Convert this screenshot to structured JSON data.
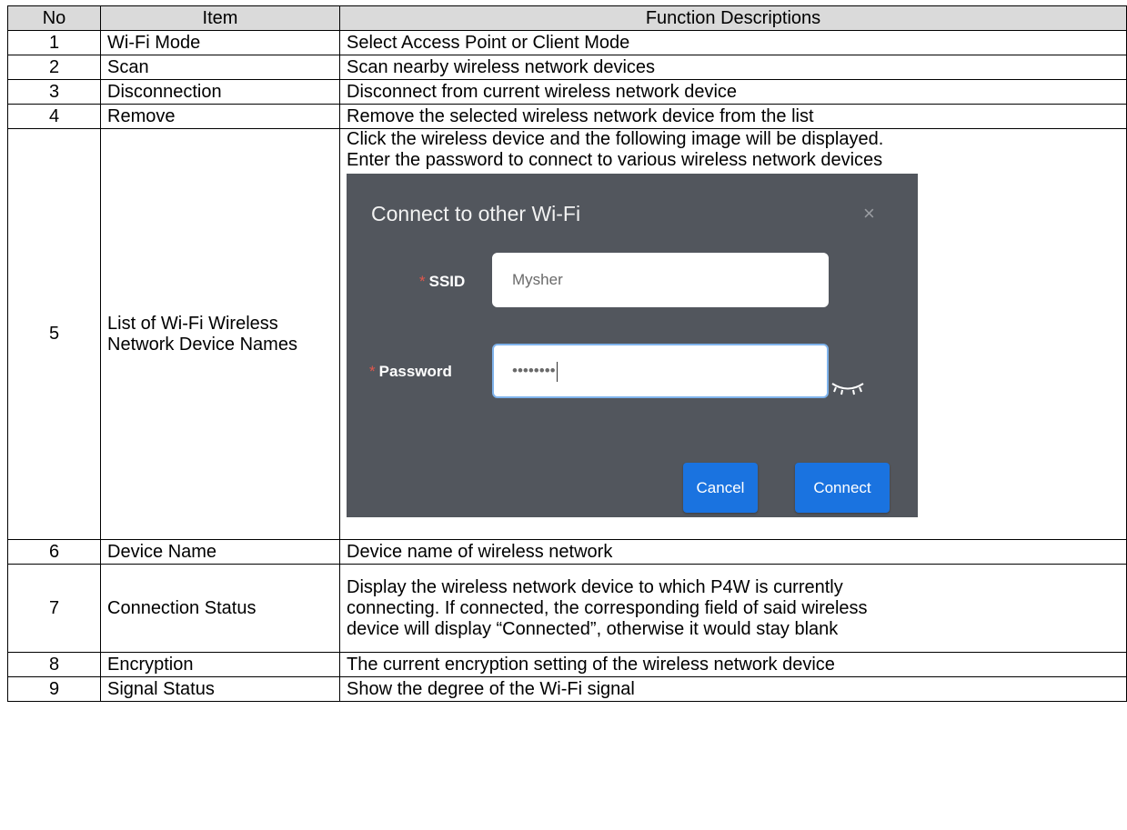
{
  "table": {
    "headers": [
      "No",
      "Item",
      "Function Descriptions"
    ],
    "rows": [
      {
        "no": "1",
        "item": "Wi-Fi Mode",
        "desc": "Select Access Point or Client Mode"
      },
      {
        "no": "2",
        "item": "Scan",
        "desc": "Scan nearby wireless network devices"
      },
      {
        "no": "3",
        "item": "Disconnection",
        "desc": "Disconnect from current wireless network device"
      },
      {
        "no": "4",
        "item": "Remove",
        "desc": "Remove the selected wireless network device from the list"
      },
      {
        "no": "5",
        "item": "List of Wi-Fi Wireless Network Device Names",
        "desc_lines": [
          "Click the wireless device and the following image will be displayed.",
          "Enter the password to connect to various wireless network devices"
        ]
      },
      {
        "no": "6",
        "item": "Device Name",
        "desc": "Device name of wireless network"
      },
      {
        "no": "7",
        "item": "Connection Status",
        "desc_lines": [
          "Display the wireless network device to which P4W is currently",
          "connecting. If connected, the corresponding field of said wireless",
          "device will display “Connected”, otherwise it would stay blank"
        ]
      },
      {
        "no": "8",
        "item": "Encryption",
        "desc": "The current encryption setting of the wireless network device"
      },
      {
        "no": "9",
        "item": "Signal Status",
        "desc": "Show the degree of the Wi-Fi signal"
      }
    ]
  },
  "dialog": {
    "title": "Connect to other Wi-Fi",
    "close_glyph": "×",
    "required_mark": "*",
    "ssid_label": "SSID",
    "ssid_value": "Mysher",
    "password_label": "Password",
    "password_value": "••••••••",
    "password_toggle_icon": "eye-closed-icon",
    "cancel_label": "Cancel",
    "connect_label": "Connect",
    "colors": {
      "background": "#52565d",
      "button": "#1a73e0",
      "required": "#e2574c",
      "focus_border": "#7fb3ec"
    }
  }
}
